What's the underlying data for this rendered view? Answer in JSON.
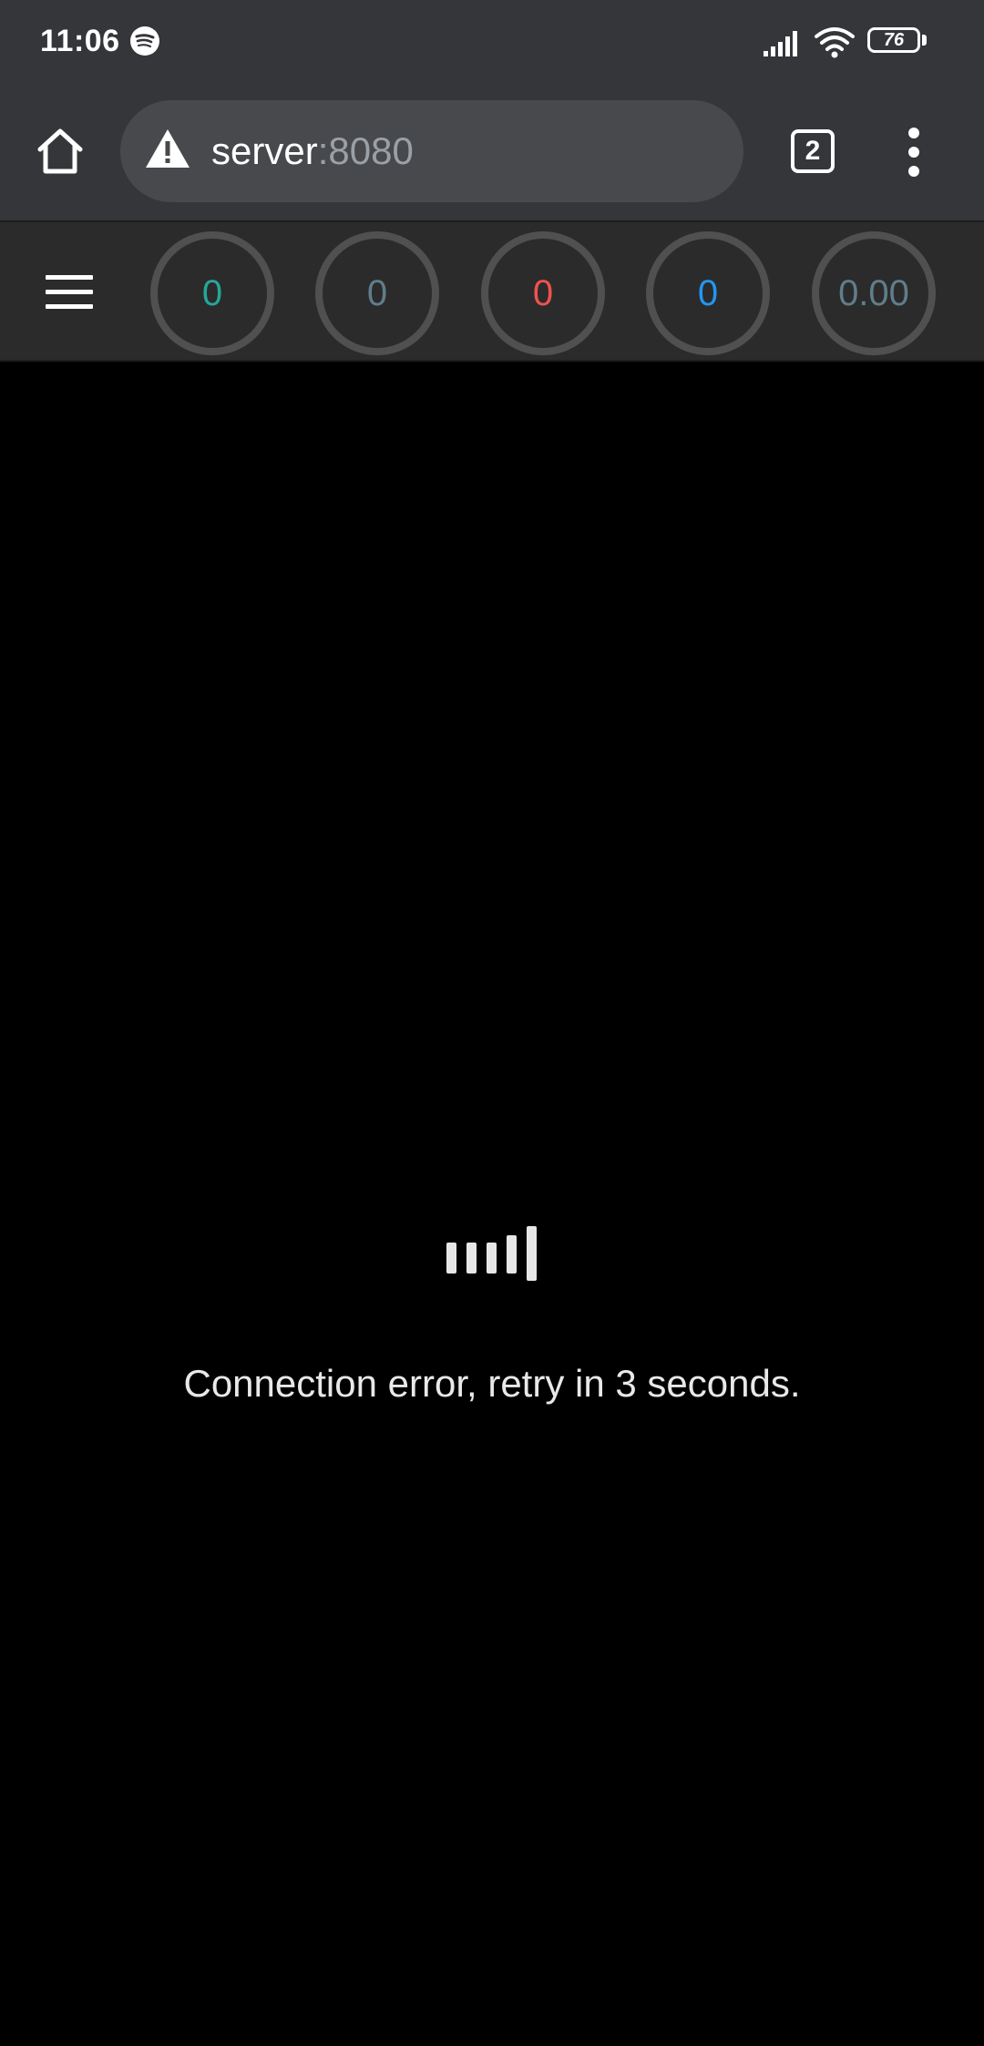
{
  "status_bar": {
    "time": "11:06",
    "battery_level": "76",
    "icons": [
      "spotify-icon",
      "signal-icon",
      "wifi-icon",
      "battery-icon"
    ]
  },
  "browser": {
    "url_host": "server",
    "url_port": ":8080",
    "tab_count": "2",
    "icons": [
      "home-icon",
      "warning-icon",
      "tabs-icon",
      "more-vert-icon"
    ]
  },
  "toolbar": {
    "menu_icon": "hamburger-menu-icon",
    "stats": [
      {
        "value": "0",
        "color": "#26a69a"
      },
      {
        "value": "0",
        "color": "#607d8b"
      },
      {
        "value": "0",
        "color": "#ef5350"
      },
      {
        "value": "0",
        "color": "#2196f3"
      },
      {
        "value": "0.00",
        "color": "#607d8b"
      }
    ]
  },
  "main": {
    "loader_icon": "loading-bars-icon",
    "error_message": "Connection error, retry in 3 seconds."
  },
  "colors": {
    "chrome_bg": "#35363a",
    "url_bg": "#48494d",
    "toolbar_bg": "#2b2b2b",
    "page_bg": "#000000"
  }
}
